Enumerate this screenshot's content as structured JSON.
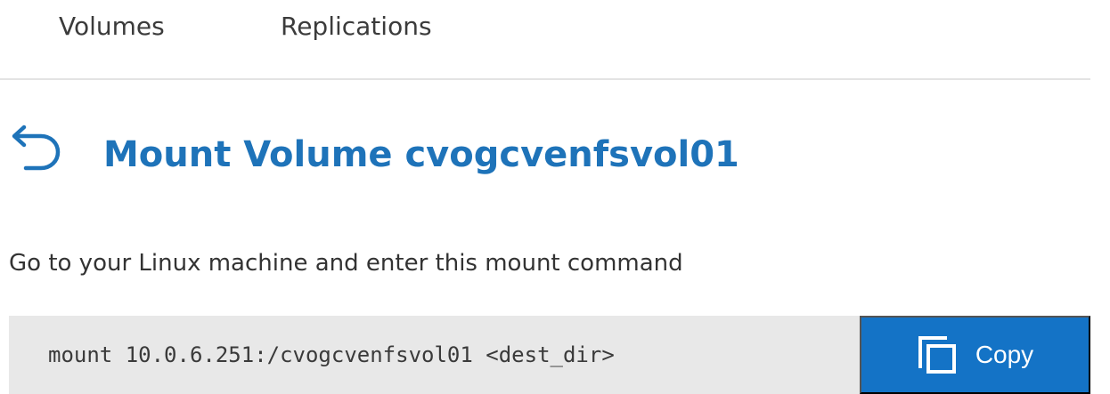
{
  "tabs": {
    "volumes_label": "Volumes",
    "replications_label": "Replications"
  },
  "header": {
    "back_icon": "undo-arrow-icon",
    "title": "Mount Volume cvogcvenfsvol01"
  },
  "main": {
    "instructions": "Go to your Linux machine and enter this mount command",
    "command": "mount 10.0.6.251:/cvogcvenfsvol01 <dest_dir>",
    "copy_label": "Copy",
    "copy_icon": "copy-icon"
  },
  "colors": {
    "accent": "#1473c6",
    "title": "#1e73b9",
    "command_background": "#e8e8e8",
    "divider": "#e3e3e3"
  }
}
